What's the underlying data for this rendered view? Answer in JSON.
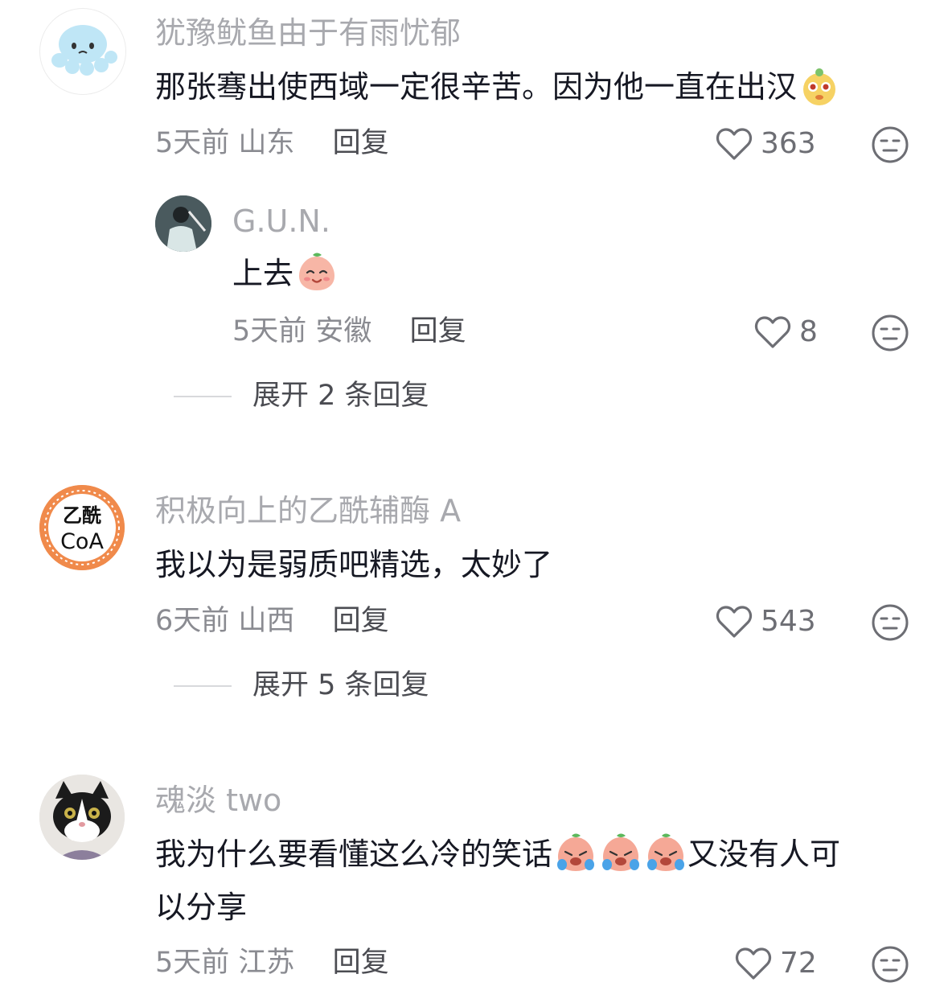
{
  "comments": [
    {
      "username": "犹豫鱿鱼由于有雨忧郁",
      "text": "那张骞出使西域一定很辛苦。因为他一直在出汉",
      "time": "5天前",
      "location": "山东",
      "reply_label": "回复",
      "likes": "363",
      "avatar_icon": "jellyfish-avatar-icon",
      "emoji_icon": "bear-emoji-icon"
    },
    {
      "username": "积极向上的乙酰辅酶 A",
      "text": "我以为是弱质吧精选，太妙了",
      "time": "6天前",
      "location": "山西",
      "reply_label": "回复",
      "likes": "543",
      "avatar_icon": "coa-badge-avatar-icon",
      "avatar_text_1": "乙酰",
      "avatar_text_2": "CoA"
    },
    {
      "username": "魂淡 two",
      "text_line1": "我为什么要看懂这么冷的笑话",
      "text_after_emoji": "又没有人可",
      "text_line2": "以分享",
      "time": "5天前",
      "location": "江苏",
      "reply_label": "回复",
      "likes": "72",
      "avatar_icon": "cat-avatar-icon",
      "emoji_icon": "crying-peach-emoji-icon"
    }
  ],
  "reply": {
    "username": "G.U.N.",
    "text": "上去",
    "time": "5天前",
    "location": "安徽",
    "reply_label": "回复",
    "likes": "8",
    "avatar_icon": "singer-avatar-icon",
    "emoji_icon": "smiling-peach-emoji-icon"
  },
  "expand_1": "展开 2 条回复",
  "expand_2": "展开 5 条回复",
  "colors": {
    "username": "#a8a9ae",
    "content": "#161823",
    "meta": "#8a8b91",
    "icon": "#6d6e74"
  }
}
